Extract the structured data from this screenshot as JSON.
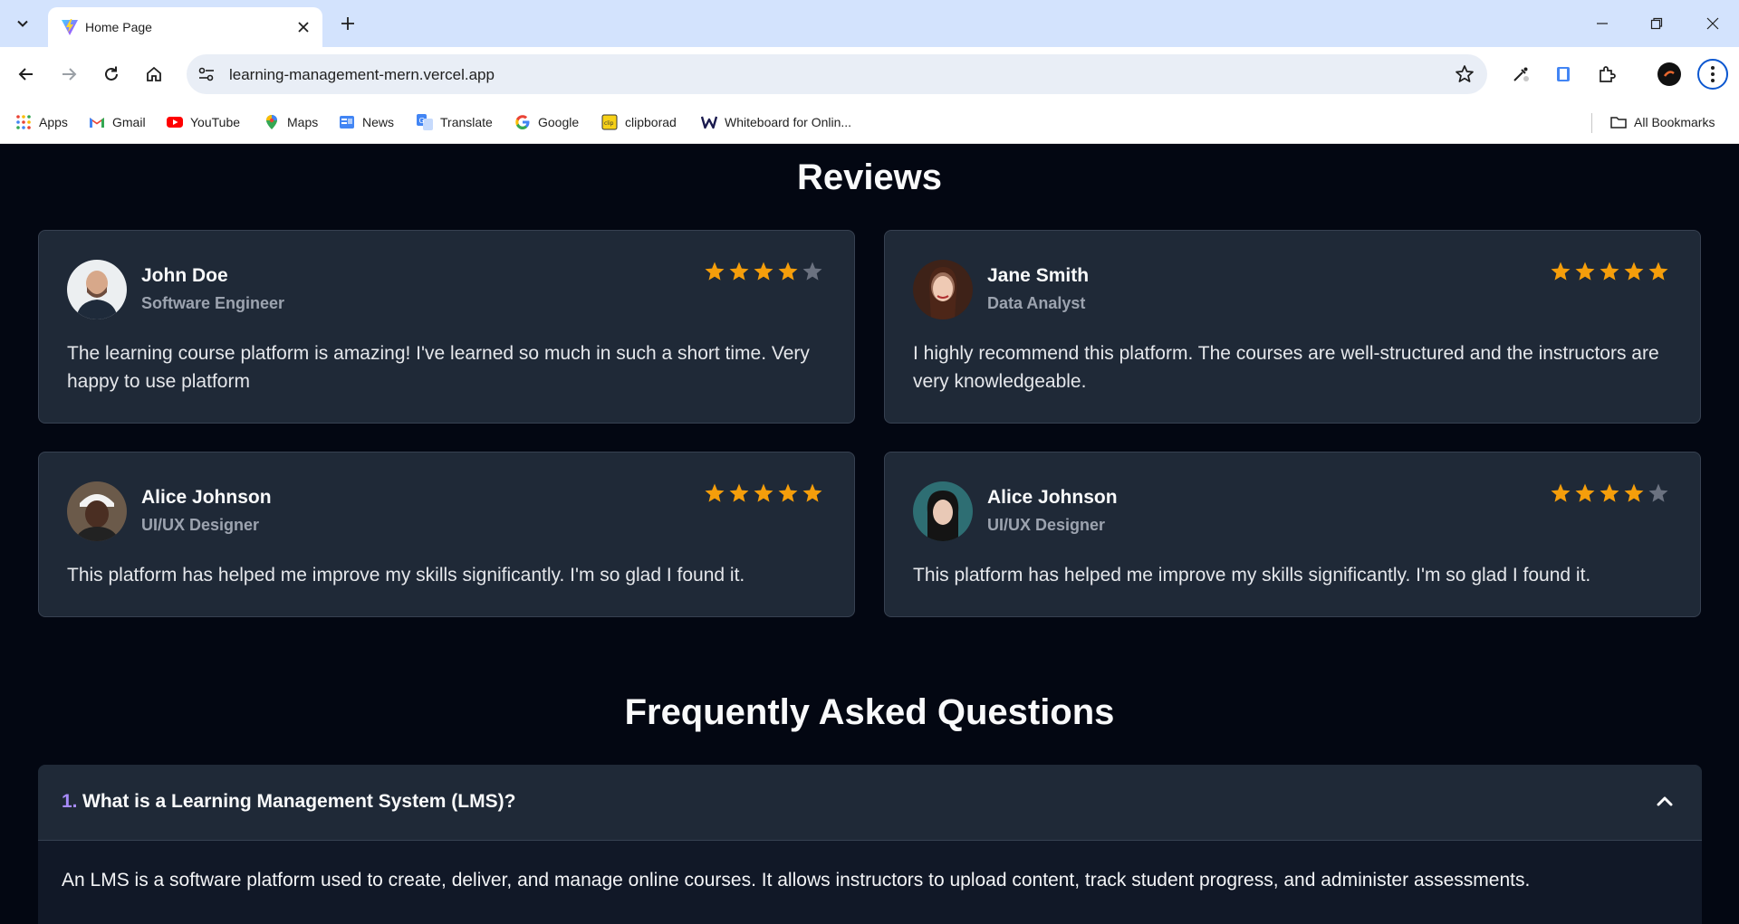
{
  "browser": {
    "tab_title": "Home Page",
    "url": "learning-management-mern.vercel.app",
    "bookmarks": [
      {
        "label": "Apps",
        "icon": "apps-grid-icon"
      },
      {
        "label": "Gmail",
        "icon": "gmail-icon"
      },
      {
        "label": "YouTube",
        "icon": "youtube-icon"
      },
      {
        "label": "Maps",
        "icon": "maps-icon"
      },
      {
        "label": "News",
        "icon": "news-icon"
      },
      {
        "label": "Translate",
        "icon": "translate-icon"
      },
      {
        "label": "Google",
        "icon": "google-icon"
      },
      {
        "label": "clipborad",
        "icon": "clipboard-icon"
      },
      {
        "label": "Whiteboard for Onlin...",
        "icon": "whiteboard-icon"
      }
    ],
    "all_bookmarks": "All Bookmarks"
  },
  "reviews": {
    "title": "Reviews",
    "items": [
      {
        "name": "John Doe",
        "role": "Software Engineer",
        "rating": 4,
        "text": "The learning course platform is amazing! I've learned so much in such a short time. Very happy to use platform"
      },
      {
        "name": "Jane Smith",
        "role": "Data Analyst",
        "rating": 5,
        "text": "I highly recommend this platform. The courses are well-structured and the instructors are very knowledgeable."
      },
      {
        "name": "Alice Johnson",
        "role": "UI/UX Designer",
        "rating": 5,
        "text": "This platform has helped me improve my skills significantly. I'm so glad I found it."
      },
      {
        "name": "Alice Johnson",
        "role": "UI/UX Designer",
        "rating": 4,
        "text": "This platform has helped me improve my skills significantly. I'm so glad I found it."
      }
    ]
  },
  "faq": {
    "title": "Frequently Asked Questions",
    "items": [
      {
        "number": "1.",
        "question": "What is a Learning Management System (LMS)?",
        "answer": "An LMS is a software platform used to create, deliver, and manage online courses. It allows instructors to upload content, track student progress, and administer assessments."
      }
    ]
  },
  "colors": {
    "page_bg": "#030712",
    "card_bg": "#1f2937",
    "star_filled": "#f59e0b",
    "star_empty": "#6b7280",
    "faq_number": "#a78bfa"
  }
}
